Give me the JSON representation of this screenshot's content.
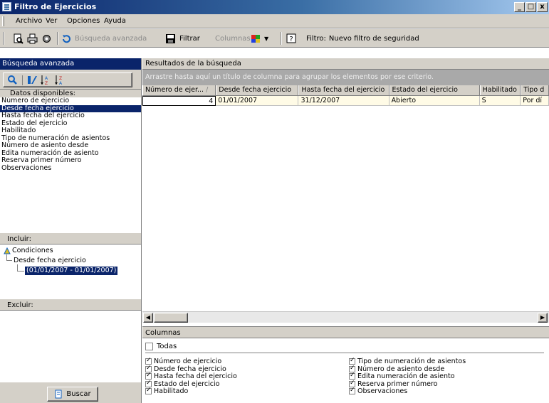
{
  "window": {
    "title": "Filtro de Ejercicios",
    "min": "_",
    "max": "□",
    "close": "x"
  },
  "menu": {
    "items": [
      {
        "label": "Archivo"
      },
      {
        "label": "Ver"
      },
      {
        "label": "Opciones"
      },
      {
        "label": "Ayuda"
      }
    ]
  },
  "toolbar": {
    "busqueda_avanzada": "Búsqueda avanzada",
    "filtrar": "Filtrar",
    "columnas": "Columnas",
    "filtro_label": "Filtro:",
    "filtro_value": "Nuevo filtro de seguridad"
  },
  "left": {
    "header": "Búsqueda avanzada",
    "datos_label": "Datos disponibles:",
    "datos": [
      "Número de ejercicio",
      "Desde fecha ejercicio",
      "Hasta fecha del ejercicio",
      "Estado del ejercicio",
      "Habilitado",
      "Tipo de numeración de asientos",
      "Número de asiento desde",
      "Edita numeración de asiento",
      "Reserva primer número",
      "Observaciones"
    ],
    "selected_index": 1,
    "incluir_label": "Incluir:",
    "tree": {
      "root": "Condiciones",
      "child": "Desde fecha ejercicio",
      "leaf": "(01/01/2007 - 01/01/2007)"
    },
    "excluir_label": "Excluir:",
    "buscar_label": "Buscar"
  },
  "results": {
    "header": "Resultados de la búsqueda",
    "group_hint": "Arrastre hasta aquí un título de columna para agrupar los elementos por ese criterio.",
    "columns": [
      "Número de ejer...",
      "Desde fecha ejercicio",
      "Hasta fecha del ejercicio",
      "Estado del ejercicio",
      "Habilitado",
      "Tipo d"
    ],
    "sort_indicator": "/",
    "rows": [
      [
        "4",
        "01/01/2007",
        "31/12/2007",
        "Abierto",
        "S",
        "Por dí"
      ]
    ]
  },
  "columnas": {
    "header": "Columnas",
    "todas": "Todas",
    "left": [
      "Número de ejercicio",
      "Desde fecha ejercicio",
      "Hasta fecha del ejercicio",
      "Estado del ejercicio",
      "Habilitado"
    ],
    "right": [
      "Tipo de numeración de asientos",
      "Número de asiento desde",
      "Edita numeración de asiento",
      "Reserva primer número",
      "Observaciones"
    ]
  }
}
